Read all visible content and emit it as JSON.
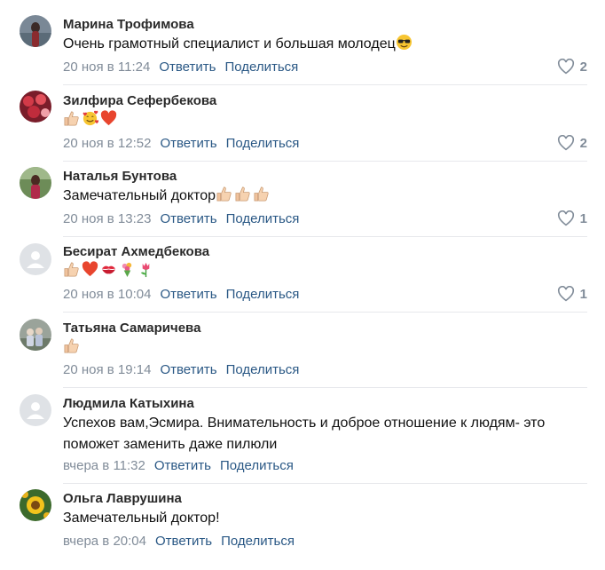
{
  "comments": [
    {
      "name": "Марина Трофимова",
      "text": "Очень грамотный специалист и большая молодец",
      "emojis": [
        "sunglasses-emoji"
      ],
      "date": "20 ноя в 11:24",
      "reply": "Ответить",
      "share": "Поделиться",
      "likes": "2",
      "avatar": "photo"
    },
    {
      "name": "Зилфира Сефербекова",
      "text": "",
      "emojis": [
        "thumbs-up-emoji",
        "smiling-hearts-emoji",
        "heart-emoji"
      ],
      "date": "20 ноя в 12:52",
      "reply": "Ответить",
      "share": "Поделиться",
      "likes": "2",
      "avatar": "photo"
    },
    {
      "name": "Наталья Бунтова",
      "text": "Замечательный доктор",
      "emojis": [
        "thumbs-up-emoji",
        "thumbs-up-emoji",
        "thumbs-up-emoji"
      ],
      "date": "20 ноя в 13:23",
      "reply": "Ответить",
      "share": "Поделиться",
      "likes": "1",
      "avatar": "photo"
    },
    {
      "name": "Бесират Ахмедбекова",
      "text": "",
      "emojis": [
        "thumbs-up-emoji",
        "heart-emoji",
        "kiss-mark-emoji",
        "bouquet-emoji",
        "tulip-emoji"
      ],
      "date": "20 ноя в 10:04",
      "reply": "Ответить",
      "share": "Поделиться",
      "likes": "1",
      "avatar": "placeholder"
    },
    {
      "name": "Татьяна Самаричева",
      "text": "",
      "emojis": [
        "thumbs-up-emoji"
      ],
      "date": "20 ноя в 19:14",
      "reply": "Ответить",
      "share": "Поделиться",
      "likes": "",
      "avatar": "photo"
    },
    {
      "name": "Людмила Катыхина",
      "text": "Успехов вам,Эсмира. Внимательность и доброе отношение к людям- это поможет заменить даже пилюли",
      "emojis": [],
      "date": "вчера в 11:32",
      "reply": "Ответить",
      "share": "Поделиться",
      "likes": "",
      "avatar": "placeholder"
    },
    {
      "name": "Ольга Лаврушина",
      "text": "Замечательный доктор!",
      "emojis": [],
      "date": "вчера в 20:04",
      "reply": "Ответить",
      "share": "Поделиться",
      "likes": "",
      "avatar": "photo"
    }
  ],
  "colors": {
    "link": "#2a5885",
    "meta": "#818c99",
    "divider": "#e7e8ec",
    "placeholder_avatar": "#dfe2e6"
  }
}
